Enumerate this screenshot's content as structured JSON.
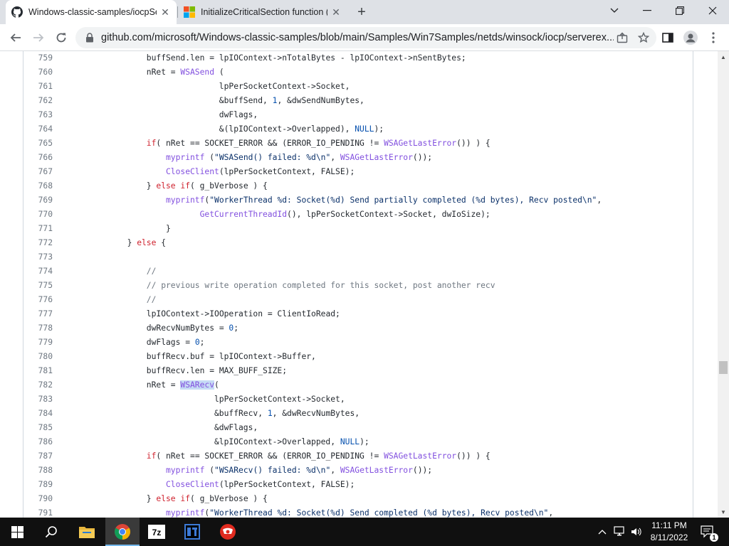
{
  "tabs": [
    {
      "title": "Windows-classic-samples/iocpSe",
      "icon": "github-icon",
      "active": true
    },
    {
      "title": "InitializeCriticalSection function (",
      "icon": "microsoft-icon",
      "active": false
    }
  ],
  "address_bar": {
    "url": "github.com/microsoft/Windows-classic-samples/blob/main/Samples/Win7Samples/netds/winsock/iocp/serverex..."
  },
  "code_lines": [
    {
      "n": "759",
      "html": "buffSend.len = lpIOContext-&gt;nTotalBytes - lpIOContext-&gt;nSentBytes;",
      "indent": 16
    },
    {
      "n": "760",
      "html": "nRet = <span class='fn'>WSASend</span> (",
      "indent": 16
    },
    {
      "n": "761",
      "html": "lpPerSocketContext-&gt;Socket,",
      "indent": 31
    },
    {
      "n": "762",
      "html": "&amp;buffSend, <span class='nu'>1</span>, &amp;dwSendNumBytes,",
      "indent": 31
    },
    {
      "n": "763",
      "html": "dwFlags,",
      "indent": 31
    },
    {
      "n": "764",
      "html": "&amp;(lpIOContext-&gt;Overlapped), <span class='nu'>NULL</span>);",
      "indent": 31
    },
    {
      "n": "765",
      "html": "<span class='kw'>if</span>( nRet == SOCKET_ERROR &amp;&amp; (ERROR_IO_PENDING != <span class='fn'>WSAGetLastError</span>()) ) {",
      "indent": 16
    },
    {
      "n": "766",
      "html": "<span class='fn'>myprintf</span> (<span class='st'>\"WSASend() failed: %d\\n\"</span>, <span class='fn'>WSAGetLastError</span>());",
      "indent": 20
    },
    {
      "n": "767",
      "html": "<span class='fn'>CloseClient</span>(lpPerSocketContext, FALSE);",
      "indent": 20
    },
    {
      "n": "768",
      "html": "} <span class='kw'>else if</span>( g_bVerbose ) {",
      "indent": 16
    },
    {
      "n": "769",
      "html": "<span class='fn'>myprintf</span>(<span class='st'>\"WorkerThread %d: Socket(%d) Send partially completed (%d bytes), Recv posted\\n\"</span>,",
      "indent": 20
    },
    {
      "n": "770",
      "html": "<span class='fn'>GetCurrentThreadId</span>(), lpPerSocketContext-&gt;Socket, dwIoSize);",
      "indent": 27
    },
    {
      "n": "771",
      "html": "}",
      "indent": 20
    },
    {
      "n": "772",
      "html": "} <span class='kw'>else</span> {",
      "indent": 12
    },
    {
      "n": "773",
      "html": "",
      "indent": 16
    },
    {
      "n": "774",
      "html": "<span class='cm'>//</span>",
      "indent": 16
    },
    {
      "n": "775",
      "html": "<span class='cm'>// previous write operation completed for this socket, post another recv</span>",
      "indent": 16
    },
    {
      "n": "776",
      "html": "<span class='cm'>//</span>",
      "indent": 16
    },
    {
      "n": "777",
      "html": "lpIOContext-&gt;IOOperation = ClientIoRead;",
      "indent": 16
    },
    {
      "n": "778",
      "html": "dwRecvNumBytes = <span class='nu'>0</span>;",
      "indent": 16
    },
    {
      "n": "779",
      "html": "dwFlags = <span class='nu'>0</span>;",
      "indent": 16
    },
    {
      "n": "780",
      "html": "buffRecv.buf = lpIOContext-&gt;Buffer,",
      "indent": 16
    },
    {
      "n": "781",
      "html": "buffRecv.len = MAX_BUFF_SIZE;",
      "indent": 16
    },
    {
      "n": "782",
      "html": "nRet = <span class='fn hl'>WSARecv</span>(",
      "indent": 16
    },
    {
      "n": "783",
      "html": "lpPerSocketContext-&gt;Socket,",
      "indent": 30
    },
    {
      "n": "784",
      "html": "&amp;buffRecv, <span class='nu'>1</span>, &amp;dwRecvNumBytes,",
      "indent": 30
    },
    {
      "n": "785",
      "html": "&amp;dwFlags,",
      "indent": 30
    },
    {
      "n": "786",
      "html": "&amp;lpIOContext-&gt;Overlapped, <span class='nu'>NULL</span>);",
      "indent": 30
    },
    {
      "n": "787",
      "html": "<span class='kw'>if</span>( nRet == SOCKET_ERROR &amp;&amp; (ERROR_IO_PENDING != <span class='fn'>WSAGetLastError</span>()) ) {",
      "indent": 16
    },
    {
      "n": "788",
      "html": "<span class='fn'>myprintf</span> (<span class='st'>\"WSARecv() failed: %d\\n\"</span>, <span class='fn'>WSAGetLastError</span>());",
      "indent": 20
    },
    {
      "n": "789",
      "html": "<span class='fn'>CloseClient</span>(lpPerSocketContext, FALSE);",
      "indent": 20
    },
    {
      "n": "790",
      "html": "} <span class='kw'>else if</span>( g_bVerbose ) {",
      "indent": 16
    },
    {
      "n": "791",
      "html": "<span class='fn'>myprintf</span>(<span class='st'>\"WorkerThread %d: Socket(%d) Send completed (%d bytes), Recv posted\\n\"</span>,",
      "indent": 20
    }
  ],
  "taskbar": {
    "apps": [
      "explorer-icon",
      "chrome-icon",
      "7zip-icon",
      "dotpeek-icon",
      "app-icon"
    ],
    "time": "11:11 PM",
    "date": "8/11/2022",
    "notification_count": "1"
  },
  "colors": {
    "keyword": "#cf222e",
    "function": "#8250df",
    "comment": "#6e7781",
    "number": "#0550ae",
    "string": "#0a3069",
    "highlight": "#c6dbf5"
  }
}
